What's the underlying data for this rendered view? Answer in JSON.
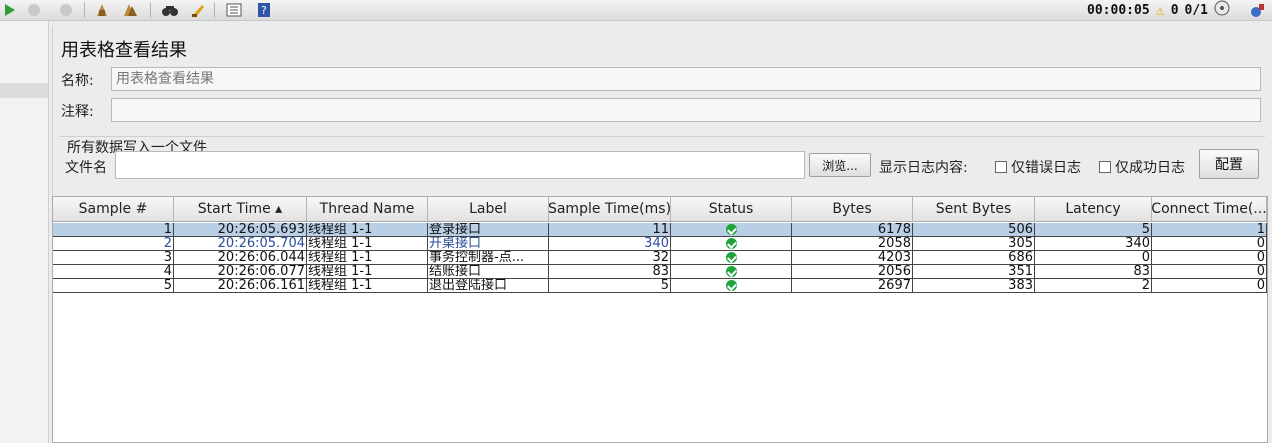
{
  "toolbar": {
    "elapsed": "00:00:05",
    "warnings": "0",
    "threads": "0/1"
  },
  "panel": {
    "title": "用表格查看结果",
    "name_label": "名称:",
    "name_value": "用表格查看结果",
    "comment_label": "注释:",
    "comment_value": "",
    "file_group_title": "所有数据写入一个文件",
    "filename_label": "文件名",
    "filename_value": "",
    "browse_label": "浏览...",
    "log_content_label": "显示日志内容:",
    "errors_only_label": "仅错误日志",
    "success_only_label": "仅成功日志",
    "configure_label": "配置"
  },
  "table": {
    "columns": [
      "Sample #",
      "Start Time ▴",
      "Thread Name",
      "Label",
      "Sample Time(ms)",
      "Status",
      "Bytes",
      "Sent Bytes",
      "Latency",
      "Connect Time(..."
    ],
    "rows": [
      {
        "sample": "1",
        "start": "20:26:05.693",
        "thread": "线程组 1-1",
        "label": "登录接口",
        "time": "11",
        "status": "ok",
        "bytes": "6178",
        "sent": "506",
        "latency": "5",
        "connect": "1"
      },
      {
        "sample": "2",
        "start": "20:26:05.704",
        "thread": "线程组 1-1",
        "label": "开桌接口",
        "time": "340",
        "status": "ok",
        "bytes": "2058",
        "sent": "305",
        "latency": "340",
        "connect": "0"
      },
      {
        "sample": "3",
        "start": "20:26:06.044",
        "thread": "线程组 1-1",
        "label": "事务控制器-点...",
        "time": "32",
        "status": "ok",
        "bytes": "4203",
        "sent": "686",
        "latency": "0",
        "connect": "0"
      },
      {
        "sample": "4",
        "start": "20:26:06.077",
        "thread": "线程组 1-1",
        "label": "结账接口",
        "time": "83",
        "status": "ok",
        "bytes": "2056",
        "sent": "351",
        "latency": "83",
        "connect": "0"
      },
      {
        "sample": "5",
        "start": "20:26:06.161",
        "thread": "线程组 1-1",
        "label": "退出登陆接口",
        "time": "5",
        "status": "ok",
        "bytes": "2697",
        "sent": "383",
        "latency": "2",
        "connect": "0"
      }
    ]
  },
  "icons": {
    "toolbar": [
      "start-icon",
      "stop-icon",
      "shutdown-icon",
      "clear-icon",
      "clear-all-icon",
      "search-icon",
      "reset-search-icon",
      "function-helper-icon",
      "help-icon",
      "warning-icon",
      "thread-indicator-icon",
      "remote-icon"
    ]
  },
  "colors": {
    "selected_row": "#b8cfe5",
    "status_ok": "#1fa33b"
  }
}
